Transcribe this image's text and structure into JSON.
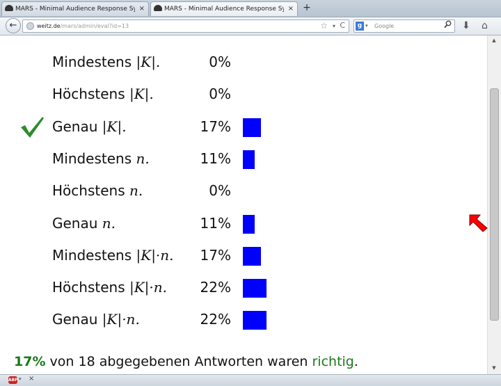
{
  "browser": {
    "tabs": [
      {
        "title": "MARS - Minimal Audience Response System",
        "close": "×",
        "active": false
      },
      {
        "title": "MARS - Minimal Audience Response System",
        "close": "×",
        "active": true
      }
    ],
    "new_tab": "+",
    "back": "←",
    "url": {
      "host": "weitz.de",
      "path": "/mars/admin/eval?id=13"
    },
    "url_icons": {
      "star": "☆",
      "dropdown": "▾",
      "reload": "C"
    },
    "search": {
      "engine_badge": "g",
      "engine_arrow": "▾",
      "placeholder": "Google",
      "icon": "search-icon"
    },
    "download_icon": "⬇",
    "home_icon": "⌂"
  },
  "results": [
    {
      "text": "Mindestens ",
      "math": "|K|.",
      "percent": "0%",
      "share": 0,
      "correct": false
    },
    {
      "text": "Höchstens ",
      "math": "|K|.",
      "percent": "0%",
      "share": 0,
      "correct": false
    },
    {
      "text": "Genau ",
      "math": "|K|.",
      "percent": "17%",
      "share": 17,
      "correct": true
    },
    {
      "text": "Mindestens ",
      "math": "n.",
      "percent": "11%",
      "share": 11,
      "correct": false
    },
    {
      "text": "Höchstens ",
      "math": "n.",
      "percent": "0%",
      "share": 0,
      "correct": false
    },
    {
      "text": "Genau ",
      "math": "n.",
      "percent": "11%",
      "share": 11,
      "correct": false
    },
    {
      "text": "Mindestens ",
      "math": "|K|·n.",
      "percent": "17%",
      "share": 17,
      "correct": false
    },
    {
      "text": "Höchstens ",
      "math": "|K|·n.",
      "percent": "22%",
      "share": 22,
      "correct": false
    },
    {
      "text": "Genau ",
      "math": "|K|·n.",
      "percent": "22%",
      "share": 22,
      "correct": false
    }
  ],
  "summary": {
    "percent": "17%",
    "middle": " von 18 abgegebenen Antworten waren ",
    "correct_word": "richtig",
    "end": "."
  },
  "addon_bar": {
    "abp_label": "ABP",
    "dropdown": "▾",
    "close": "×"
  },
  "colors": {
    "bar": "#0000ff",
    "check": "#2e8b2e",
    "correct_text": "#1a7a1a",
    "cursor": "#ff0000"
  }
}
